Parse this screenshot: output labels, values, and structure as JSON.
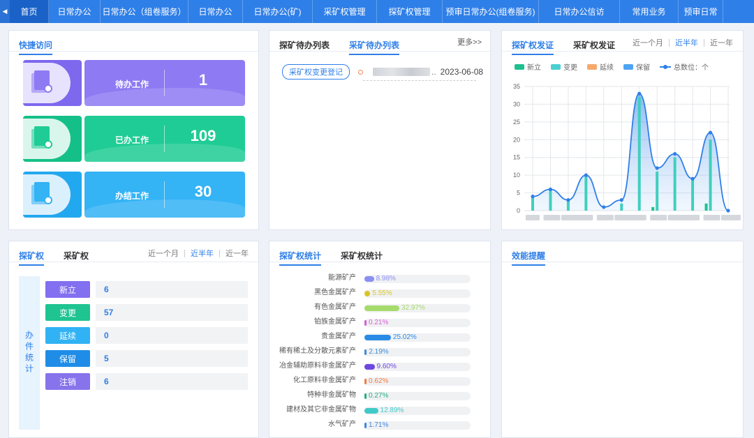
{
  "nav": {
    "arrow": "◀",
    "items": [
      {
        "label": "首页",
        "w": 56,
        "active": true
      },
      {
        "label": "日常办公",
        "w": 74
      },
      {
        "label": "日常办公（组卷服务）",
        "w": 126
      },
      {
        "label": "日常办公",
        "w": 78
      },
      {
        "label": "日常办公(矿)",
        "w": 100
      },
      {
        "label": "采矿权管理",
        "w": 92
      },
      {
        "label": "探矿权管理",
        "w": 94
      },
      {
        "label": "预审日常办公(组卷服务)",
        "w": 138
      },
      {
        "label": "日常办公信访",
        "w": 116
      },
      {
        "label": "常用业务",
        "w": 84
      },
      {
        "label": "预审日常",
        "w": 64
      }
    ]
  },
  "quick": {
    "title": "快捷访问",
    "cards": [
      {
        "label": "待办工作",
        "count": "1",
        "main": "#8e7bf3",
        "icon_bg": "#7d68ee",
        "blob": "#e7e2fd",
        "doc": "#8e7bf3"
      },
      {
        "label": "已办工作",
        "count": "109",
        "main": "#20cc95",
        "icon_bg": "#14c088",
        "blob": "#d9f6ec",
        "doc": "#20cc95"
      },
      {
        "label": "办结工作",
        "count": "30",
        "main": "#34b3f5",
        "icon_bg": "#22a8ef",
        "blob": "#dbf0fd",
        "doc": "#34b3f5"
      }
    ]
  },
  "todo": {
    "tabs": [
      "探矿待办列表",
      "采矿待办列表"
    ],
    "active": 1,
    "more": "更多>>",
    "item": {
      "tag": "采矿权变更登记",
      "ellipsis": "..",
      "date": "2023-06-08"
    }
  },
  "issue": {
    "tabs": [
      "探矿权发证",
      "采矿权发证"
    ],
    "active": 0,
    "ranges": [
      "近一个月",
      "近半年",
      "近一年"
    ],
    "range_active": 1
  },
  "legend": [
    {
      "label": "新立",
      "color": "#1fc08f"
    },
    {
      "label": "变更",
      "color": "#4bcfd1"
    },
    {
      "label": "延续",
      "color": "#f6a96b"
    },
    {
      "label": "保留",
      "color": "#4ea4f2"
    }
  ],
  "legend_line": "总数位：个",
  "chart_data": {
    "type": "line",
    "ylim": [
      0,
      35
    ],
    "yticks": [
      0,
      5,
      10,
      15,
      20,
      25,
      30,
      35
    ],
    "total": [
      4,
      6,
      3,
      10,
      1,
      3,
      33,
      12,
      16,
      9,
      22,
      0
    ],
    "bars": [
      4,
      6,
      3,
      10,
      0,
      2,
      32,
      11,
      15,
      9,
      20,
      0
    ],
    "bars_small": [
      0,
      0,
      0,
      0,
      0,
      0,
      0,
      1,
      0,
      0,
      2,
      0
    ]
  },
  "stats": {
    "tabs": [
      "探矿权",
      "采矿权"
    ],
    "active": 0,
    "ranges": [
      "近一个月",
      "近半年",
      "近一年"
    ],
    "range_active": 1,
    "side_label": "办件统计",
    "rows": [
      {
        "label": "新立",
        "value": "6",
        "color": "#8270f0"
      },
      {
        "label": "变更",
        "value": "57",
        "color": "#1fc490"
      },
      {
        "label": "延续",
        "value": "0",
        "color": "#31b2f4"
      },
      {
        "label": "保留",
        "value": "5",
        "color": "#1f8de7"
      },
      {
        "label": "注销",
        "value": "6",
        "color": "#8774ec"
      }
    ]
  },
  "minerals": {
    "tabs": [
      "探矿权统计",
      "采矿权统计"
    ],
    "active": 0,
    "rows": [
      {
        "label": "能源矿产",
        "pct": "8.98%",
        "value": 8.98,
        "color": "#8a8ff1"
      },
      {
        "label": "黑色金属矿产",
        "pct": "5.55%",
        "value": 5.55,
        "color": "#d8c524"
      },
      {
        "label": "有色金属矿产",
        "pct": "32.97%",
        "value": 32.97,
        "color": "#a5db6a"
      },
      {
        "label": "铂族金属矿产",
        "pct": "0.21%",
        "value": 0.21,
        "color": "#d45ed4"
      },
      {
        "label": "贵金属矿产",
        "pct": "25.02%",
        "value": 25.02,
        "color": "#2a8be6"
      },
      {
        "label": "稀有稀土及分散元素矿产",
        "pct": "2.19%",
        "value": 2.19,
        "color": "#3b8cd9"
      },
      {
        "label": "冶金辅助原料非金属矿产",
        "pct": "9.60%",
        "value": 9.6,
        "color": "#6e46e0"
      },
      {
        "label": "化工原料非金属矿产",
        "pct": "0.62%",
        "value": 0.62,
        "color": "#f37a3d"
      },
      {
        "label": "特种非金属矿物",
        "pct": "0.27%",
        "value": 0.27,
        "color": "#22b07e"
      },
      {
        "label": "建材及其它非金属矿物",
        "pct": "12.89%",
        "value": 12.89,
        "color": "#3fcac8"
      },
      {
        "label": "水气矿产",
        "pct": "1.71%",
        "value": 1.71,
        "color": "#3d86e0"
      }
    ]
  },
  "efficiency": {
    "title": "效能提醒"
  }
}
